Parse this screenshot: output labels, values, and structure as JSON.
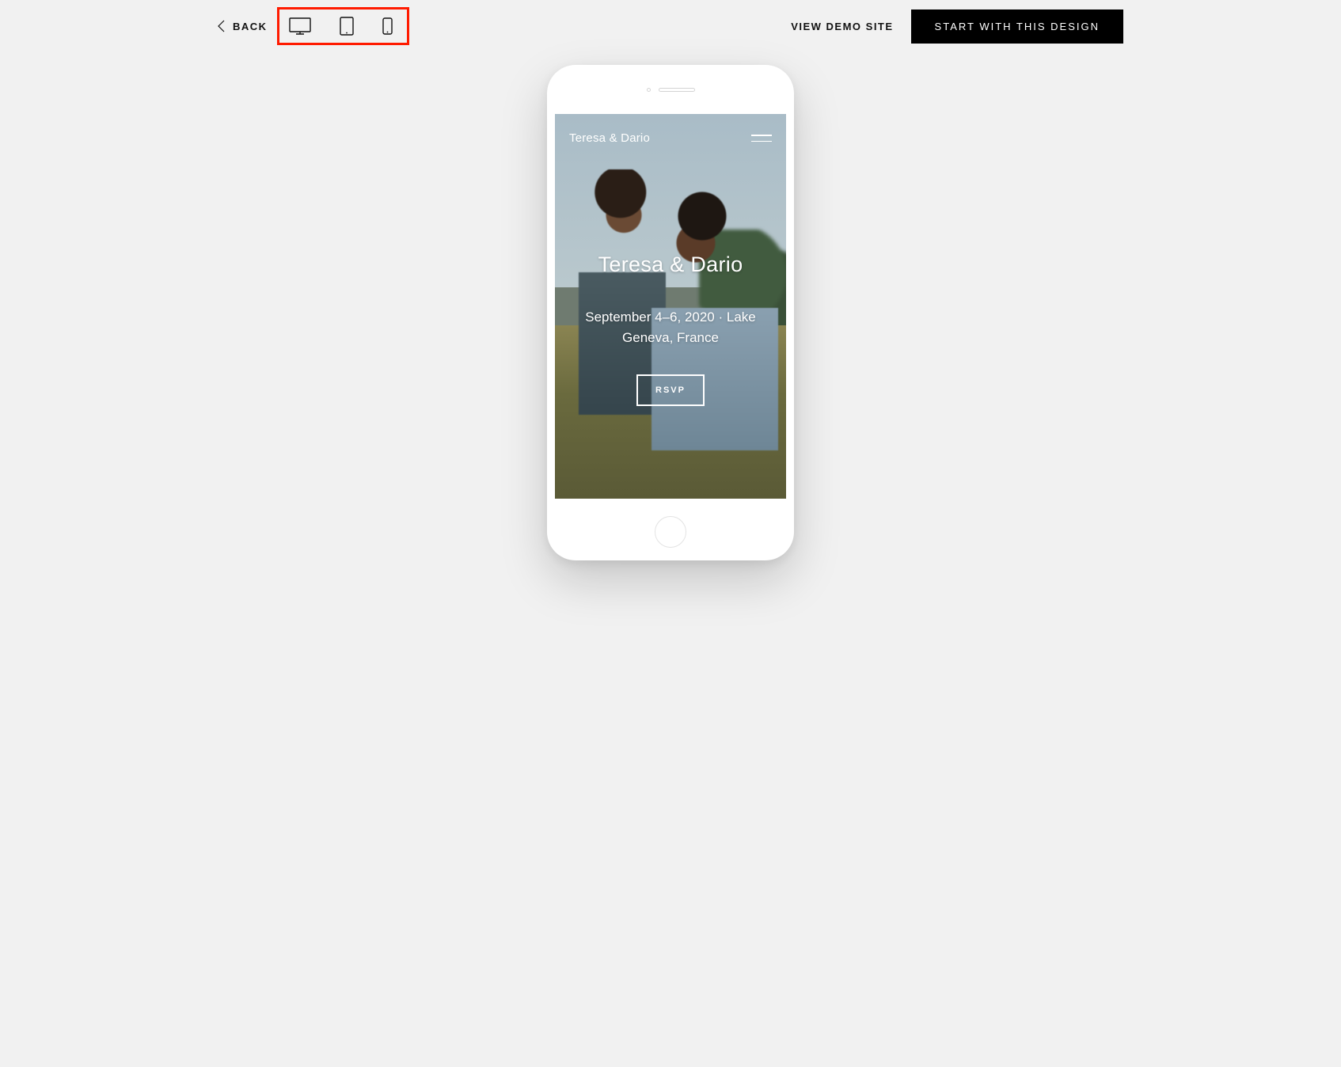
{
  "topbar": {
    "back_label": "BACK",
    "view_demo_label": "VIEW DEMO SITE",
    "cta_label": "START WITH THIS DESIGN"
  },
  "preview": {
    "site_title_small": "Teresa & Dario",
    "hero_title": "Teresa & Dario",
    "hero_subtitle": "September 4–6, 2020 · Lake Geneva, France",
    "rsvp_label": "RSVP"
  }
}
